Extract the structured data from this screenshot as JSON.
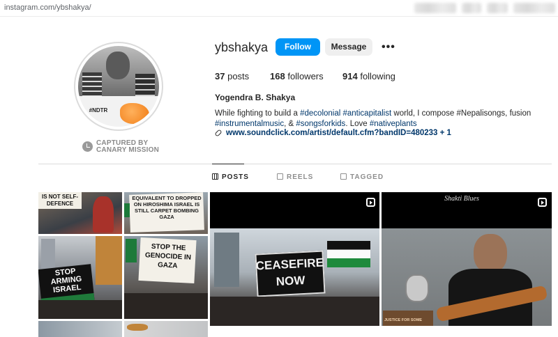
{
  "browser": {
    "url": "instagram.com/ybshakya/"
  },
  "profile": {
    "avatar_tag": "#NDTR",
    "captured_line1": "CAPTURED BY",
    "captured_line2": "CANARY MISSION",
    "username": "ybshakya",
    "follow_label": "Follow",
    "message_label": "Message",
    "more_label": "•••",
    "posts_count": "37",
    "posts_label": "posts",
    "followers_count": "168",
    "followers_label": "followers",
    "following_count": "914",
    "following_label": "following",
    "full_name": "Yogendra B. Shakya",
    "bio": {
      "p1": "While fighting to build a ",
      "h1": "#decolonial",
      "p2": " ",
      "h2": "#anticapitalist",
      "p3": " world, I compose #Nepalisongs, fusion",
      "h3": "#instrumentalmusic",
      "p4": ", & ",
      "h4": "#songsforkids",
      "p5": ". Love ",
      "h5": "#nativeplants"
    },
    "link": "www.soundclick.com/artist/default.cfm?bandID=480233 + 1"
  },
  "tabs": [
    {
      "label": "POSTS",
      "icon": "grid-icon",
      "active": true
    },
    {
      "label": "REELS",
      "icon": "reels-icon",
      "active": false
    },
    {
      "label": "TAGGED",
      "icon": "tagged-icon",
      "active": false
    }
  ],
  "grid": {
    "cell1_text": "IS NOT SELF-DEFENCE",
    "cell2_text": "EQUIVALENT TO DROPPED ON HIROSHIMA ISRAEL IS STILL CARPET BOMBING GAZA",
    "cell4_text": "STOP ARMING ISRAEL",
    "cell5_text": "STOP THE GENOCIDE IN GAZA",
    "big1_text": "CEASEFIRE NOW",
    "big2_title": "Shakti Blues",
    "big2_caption": "JUSTICE FOR SOME"
  },
  "colors": {
    "follow_blue": "#0095f6",
    "hashtag": "#00376b",
    "captured_gray": "#8a8a8a"
  }
}
